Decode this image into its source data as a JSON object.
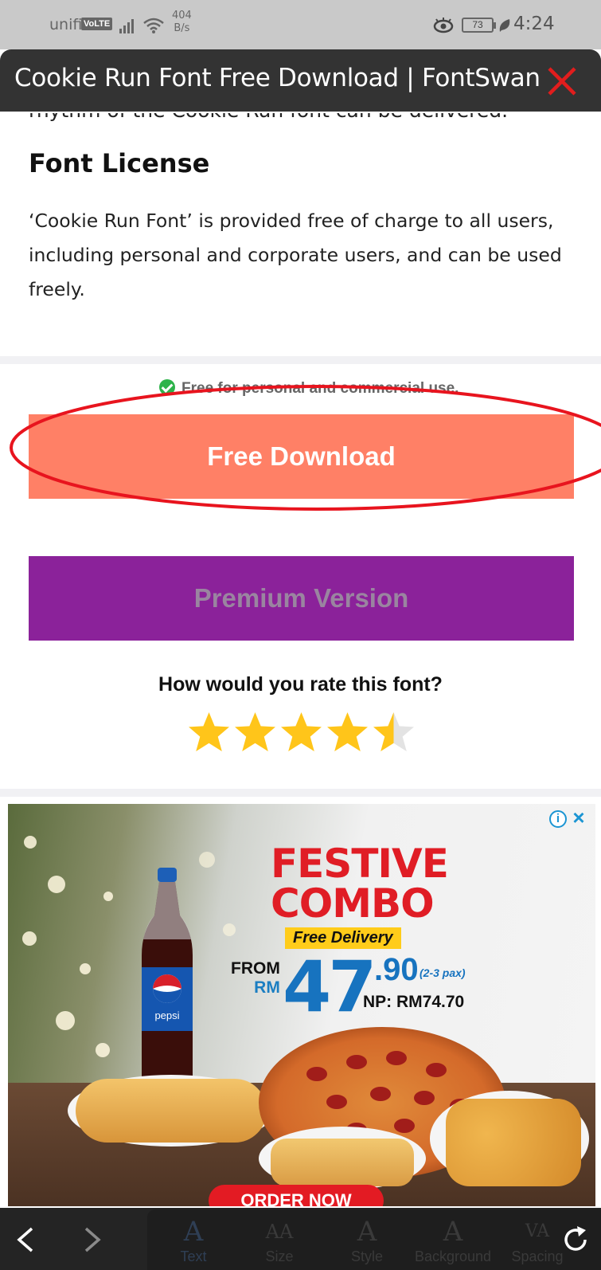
{
  "status_bar": {
    "carrier": "unifi",
    "volte": "VoLTE",
    "speed_value": "404",
    "speed_unit": "B/s",
    "battery": "73",
    "time": "4:24"
  },
  "header": {
    "title": "Cookie Run Font Free Download | FontSwan",
    "close_icon": "close-icon",
    "close_color": "#e11d1d"
  },
  "content": {
    "cut_line": "rhythm of the Cookie Run font can be delivered.",
    "license_heading": "Font License",
    "license_paragraph": "‘Cookie Run Font’ is provided free of charge to all users, including personal and corporate users, and can be used freely.",
    "free_note": "Free for personal and commercial use.",
    "free_download_label": "Free Download",
    "premium_label": "Premium Version",
    "rating_question": "How would you rate this font?",
    "rating": 4.5,
    "rating_max": 5
  },
  "ad": {
    "headline_line1": "FESTIVE",
    "headline_line2": "COMBO",
    "delivery": "Free Delivery",
    "from": "FROM",
    "currency": "RM",
    "price_whole": "47",
    "price_cents": ".90",
    "pax": "(2-3 pax)",
    "normal_price": "NP: RM74.70",
    "order_button": "ORDER NOW",
    "bottle_label": "pepsi",
    "info_icon": "info-icon",
    "close_icon": "close-icon"
  },
  "toolbar": {
    "back_icon": "chevron-left-icon",
    "forward_icon": "chevron-right-icon",
    "refresh_icon": "refresh-icon",
    "items": [
      {
        "glyph": "A",
        "label": "Text"
      },
      {
        "glyph": "AA",
        "label": "Size"
      },
      {
        "glyph": "A",
        "label": "Style"
      },
      {
        "glyph": "A",
        "label": "Background"
      },
      {
        "glyph": "VA",
        "label": "Spacing"
      }
    ]
  },
  "colors": {
    "free_download_bg": "#ff8066",
    "premium_bg": "#8b229a",
    "annotation_stroke": "#e8141e",
    "star_fill": "#ffc51a"
  }
}
